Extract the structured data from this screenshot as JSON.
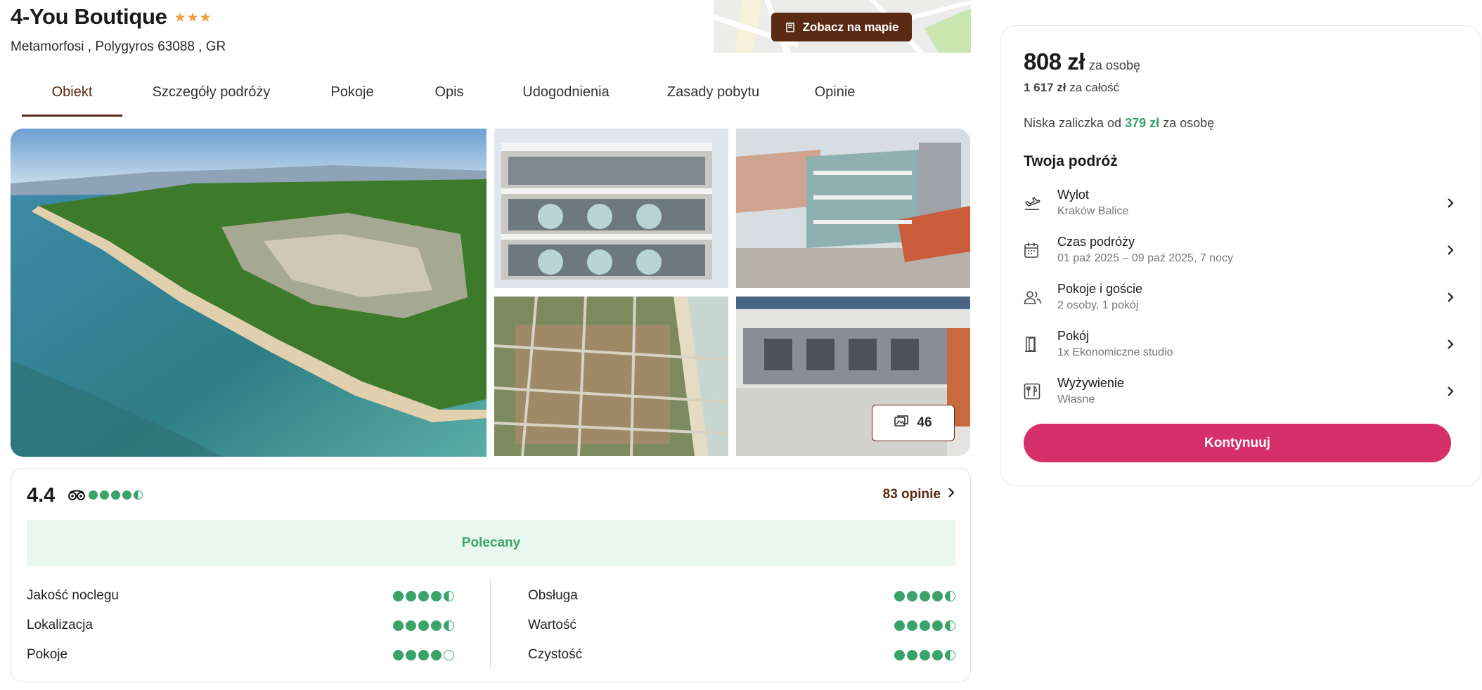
{
  "hotel": {
    "name": "4-You Boutique",
    "stars": "★★★",
    "location": "Metamorfosi , Polygyros 63088 , GR"
  },
  "map_button": {
    "label": "Zobacz na mapie",
    "icon": "map-pin-icon"
  },
  "tabs": [
    {
      "label": "Obiekt",
      "active": true
    },
    {
      "label": "Szczegóły podróży"
    },
    {
      "label": "Pokoje"
    },
    {
      "label": "Opis"
    },
    {
      "label": "Udogodnienia"
    },
    {
      "label": "Zasady pobytu"
    },
    {
      "label": "Opinie"
    }
  ],
  "gallery": {
    "photo_count": "46",
    "icon": "photos-icon"
  },
  "rating": {
    "score": "4.4",
    "score_dots": 4.5,
    "reviews_label": "83 opinie",
    "recommended_label": "Polecany",
    "categories_left": [
      {
        "label": "Jakość noclegu",
        "dots": 4.5
      },
      {
        "label": "Lokalizacja",
        "dots": 4.5
      },
      {
        "label": "Pokoje",
        "dots": 4
      }
    ],
    "categories_right": [
      {
        "label": "Obsługa",
        "dots": 4.5
      },
      {
        "label": "Wartość",
        "dots": 4.5
      },
      {
        "label": "Czystość",
        "dots": 4.5
      }
    ]
  },
  "booking": {
    "price": "808 zł",
    "per_person": "za osobę",
    "total_amount": "1 617 zł",
    "total_label": "za całość",
    "deposit_prefix": "Niska zaliczka od",
    "deposit_amount": "379 zł",
    "deposit_suffix": "za osobę",
    "trip_title": "Twoja podróż",
    "trip_items": [
      {
        "label": "Wylot",
        "value": "Kraków Balice",
        "icon": "plane-departure-icon"
      },
      {
        "label": "Czas podróży",
        "value": "01 paź 2025 – 09 paź 2025, 7 nocy",
        "icon": "calendar-icon"
      },
      {
        "label": "Pokoje i goście",
        "value": "2 osoby, 1 pokój",
        "icon": "users-icon"
      },
      {
        "label": "Pokój",
        "value": "1x Ekonomiczne studio",
        "icon": "door-icon"
      },
      {
        "label": "Wyżywienie",
        "value": "Własne",
        "icon": "utensils-icon"
      }
    ],
    "continue_label": "Kontynuuj"
  },
  "colors": {
    "brand_brown": "#5b2a12",
    "accent_pink": "#d6306a",
    "rating_green": "#3aa368",
    "recommended_bg": "#eaf7ee"
  }
}
